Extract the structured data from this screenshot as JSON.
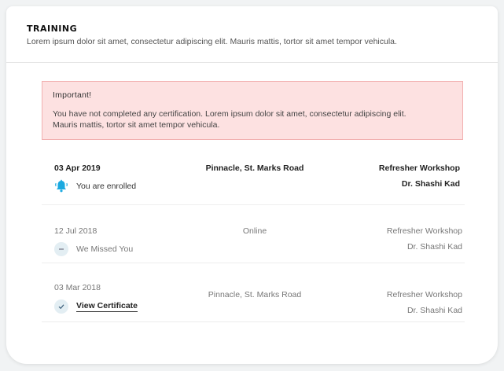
{
  "header": {
    "title": "TRAINING",
    "subtitle": "Lorem ipsum dolor sit amet, consectetur adipiscing elit. Mauris mattis, tortor sit amet tempor vehicula."
  },
  "alert": {
    "title": "Important!",
    "line1": "You have not completed any certification. Lorem ipsum dolor sit amet, consectetur adipiscing elit.",
    "line2": "Mauris mattis, tortor sit amet tempor vehicula."
  },
  "sessions": [
    {
      "date": "03 Apr 2019",
      "venue": "Pinnacle, St. Marks Road",
      "program": "Refresher Workshop",
      "trainer": "Dr. Shashi Kad",
      "status": "You are enrolled",
      "status_icon": "bell-icon"
    },
    {
      "date": "12 Jul 2018",
      "venue": "Online",
      "program": "Refresher Workshop",
      "trainer": "Dr. Shashi Kad",
      "status": "We Missed You",
      "status_icon": "minus-circle-icon"
    },
    {
      "date": "03 Mar 2018",
      "venue": "Pinnacle, St. Marks Road",
      "program": "Refresher Workshop",
      "trainer": "Dr. Shashi Kad",
      "status": "View Certificate",
      "status_icon": "check-circle-icon"
    }
  ],
  "colors": {
    "alert_bg": "#fde1e1",
    "alert_border": "#f2b0b0",
    "bell": "#1aa9e0",
    "icon_circle": "#e3eef3"
  }
}
